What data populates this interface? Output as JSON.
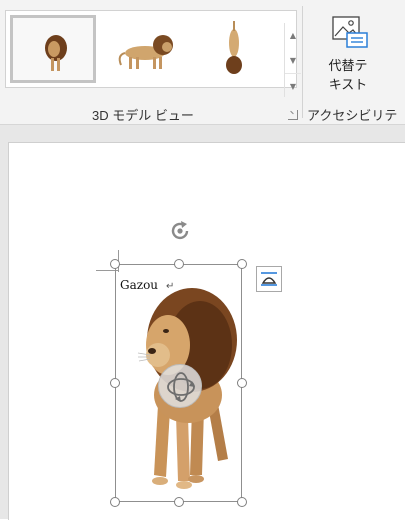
{
  "ribbon": {
    "views_gallery": {
      "group_label": "3D モデル ビュー",
      "items": [
        {
          "name": "front-view",
          "selected": true
        },
        {
          "name": "side-view",
          "selected": false
        },
        {
          "name": "top-view",
          "selected": false
        }
      ]
    },
    "accessibility": {
      "group_label": "アクセシビリティ",
      "alt_text_line1": "代替テ",
      "alt_text_line2": "キスト"
    }
  },
  "document": {
    "text": "Gazou",
    "paragraph_mark": "↵"
  },
  "icons": {
    "rotate": "rotate-handle-icon",
    "orbit": "3d-rotate-icon",
    "layout": "layout-options-icon",
    "alt_text": "alt-text-icon"
  },
  "colors": {
    "accent": "#2b7fd8",
    "handle_border": "#7f7f7f"
  }
}
